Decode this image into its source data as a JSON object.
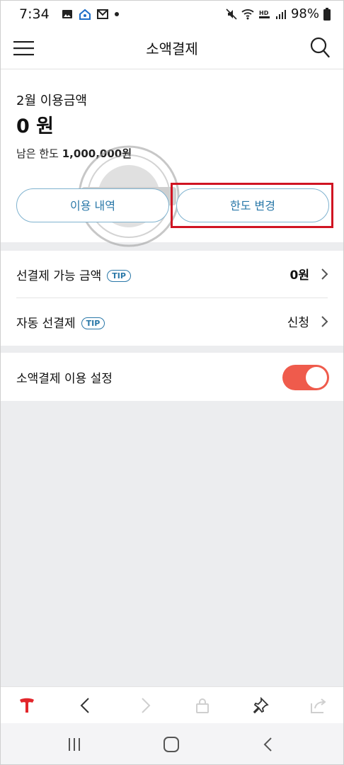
{
  "status_bar": {
    "time": "7:34",
    "battery": "98%",
    "icons": [
      "gallery-icon",
      "home-icon",
      "mail-icon",
      "dot-icon",
      "mute-icon",
      "wifi-icon",
      "hd-voice-icon",
      "signal-icon",
      "battery-icon"
    ]
  },
  "header": {
    "title": "소액결제",
    "menu_icon": "hamburger-menu-icon",
    "search_icon": "search-icon"
  },
  "summary": {
    "month_label": "2월 이용금액",
    "amount": "0 원",
    "remaining_label": "남은 한도",
    "remaining_value": "1,000,000원",
    "history_button": "이용 내역",
    "limit_button": "한도 변경"
  },
  "list": {
    "prepay_label": "선결제 가능 금액",
    "prepay_tip": "TIP",
    "prepay_value": "0원",
    "auto_label": "자동 선결제",
    "auto_tip": "TIP",
    "auto_value": "신청"
  },
  "setting": {
    "label": "소액결제 이용 설정",
    "enabled": true
  },
  "colors": {
    "accent": "#2a78a8",
    "toggle_on": "#ef5b4c",
    "highlight": "#d01422",
    "logo": "#e2262b"
  }
}
